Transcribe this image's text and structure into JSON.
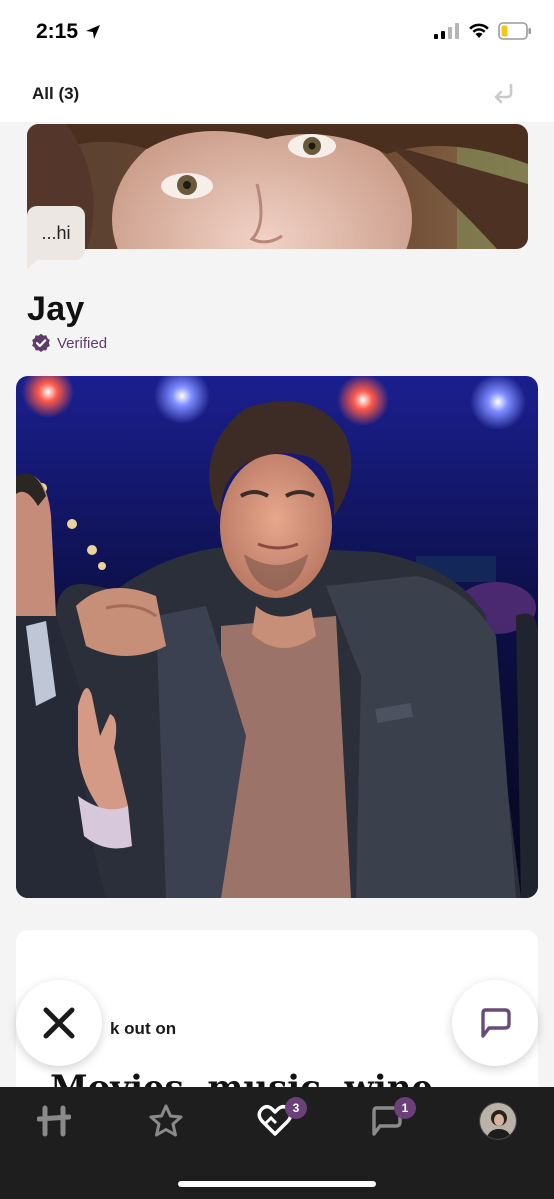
{
  "status_bar": {
    "time": "2:15",
    "location_icon": "location-arrow-icon",
    "signal_icon": "cellular-signal-icon",
    "wifi_icon": "wifi-icon",
    "battery_icon": "battery-low-icon",
    "battery_color": "#f5c518"
  },
  "header": {
    "filter_label": "All (3)",
    "undo_icon": "undo-arrow-icon"
  },
  "match_preview": {
    "message": "...hi"
  },
  "profile": {
    "name": "Jay",
    "verified_label": "Verified",
    "verified_icon": "verified-badge-icon",
    "accent_color": "#5f3b6a"
  },
  "prompt": {
    "question": "k out on",
    "answer": "Movies, music, wine"
  },
  "actions": {
    "skip_icon": "close-x-icon",
    "comment_icon": "chat-bubble-icon"
  },
  "tab_bar": {
    "tabs": [
      {
        "name": "discover",
        "icon": "hinge-logo-icon"
      },
      {
        "name": "standouts",
        "icon": "star-icon"
      },
      {
        "name": "likes-you",
        "icon": "heart-icon",
        "badge": "3"
      },
      {
        "name": "matches",
        "icon": "chat-icon",
        "badge": "1"
      },
      {
        "name": "profile",
        "icon": "avatar"
      }
    ],
    "badge_color": "#6b3f7a"
  }
}
